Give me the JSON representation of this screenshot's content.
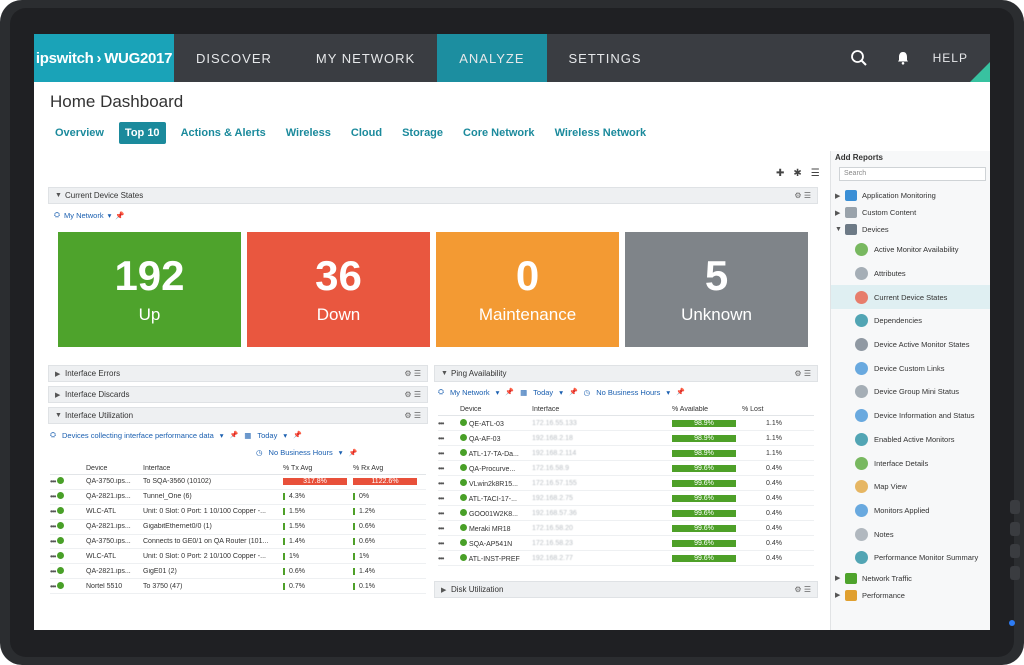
{
  "nav": {
    "brand": {
      "name": "ipswitch",
      "product": "WUG2017"
    },
    "items": [
      {
        "label": "DISCOVER"
      },
      {
        "label": "MY NETWORK"
      },
      {
        "label": "ANALYZE"
      },
      {
        "label": "SETTINGS"
      }
    ],
    "active": "ANALYZE",
    "help": "HELP"
  },
  "page": {
    "title": "Home Dashboard"
  },
  "tabs": [
    "Overview",
    "Top 10",
    "Actions & Alerts",
    "Wireless",
    "Cloud",
    "Storage",
    "Core Network",
    "Wireless Network"
  ],
  "active_tab": "Top 10",
  "current_device_states": {
    "title": "Current Device States",
    "scope": "My Network",
    "tiles": [
      {
        "count": "192",
        "label": "Up",
        "color": "#4ea32c"
      },
      {
        "count": "36",
        "label": "Down",
        "color": "#e9573f"
      },
      {
        "count": "0",
        "label": "Maintenance",
        "color": "#f39a33"
      },
      {
        "count": "5",
        "label": "Unknown",
        "color": "#7f8489"
      }
    ]
  },
  "panels": {
    "interface_errors": "Interface Errors",
    "interface_discards": "Interface Discards",
    "interface_utilization": "Interface Utilization",
    "ping_availability": "Ping Availability",
    "disk_utilization": "Disk Utilization"
  },
  "interface_utilization": {
    "scope": "Devices collecting interface performance data",
    "range": "Today",
    "hours": "No Business Hours",
    "columns": [
      "Device",
      "Interface",
      "% Tx Avg",
      "% Rx Avg"
    ],
    "rows": [
      {
        "device": "QA-3750.ips...",
        "iface": "To SQA-3560 (10102)",
        "tx": "317.8%",
        "rx": "1122.6%"
      },
      {
        "device": "QA-2821.ips...",
        "iface": "Tunnel_One (6)",
        "tx": "4.3%",
        "rx": "0%"
      },
      {
        "device": "WLC-ATL",
        "iface": "Unit: 0 Slot: 0 Port: 1 10/100 Copper -...",
        "tx": "1.5%",
        "rx": "1.2%"
      },
      {
        "device": "QA-2821.ips...",
        "iface": "GigabitEthernet0/0 (1)",
        "tx": "1.5%",
        "rx": "0.6%"
      },
      {
        "device": "QA-3750.ips...",
        "iface": "Connects to GE0/1 on QA Router (101...",
        "tx": "1.4%",
        "rx": "0.6%"
      },
      {
        "device": "WLC-ATL",
        "iface": "Unit: 0 Slot: 0 Port: 2 10/100 Copper -...",
        "tx": "1%",
        "rx": "1%"
      },
      {
        "device": "QA-2821.ips...",
        "iface": "GigE01 (2)",
        "tx": "0.6%",
        "rx": "1.4%"
      },
      {
        "device": "Nortel 5510",
        "iface": "To 3750 (47)",
        "tx": "0.7%",
        "rx": "0.1%"
      }
    ]
  },
  "ping_availability": {
    "scope": "My Network",
    "range": "Today",
    "hours": "No Business Hours",
    "columns": [
      "Device",
      "Interface",
      "% Available",
      "% Lost"
    ],
    "rows": [
      {
        "device": "QE-ATL-03",
        "iface": "172.16.55.133",
        "avail": "98.9%",
        "lost": "1.1%"
      },
      {
        "device": "QA-AF-03",
        "iface": "192.168.2.18",
        "avail": "98.9%",
        "lost": "1.1%"
      },
      {
        "device": "ATL-17-TA-Da...",
        "iface": "192.168.2.114",
        "avail": "98.9%",
        "lost": "1.1%"
      },
      {
        "device": "QA-Procurve...",
        "iface": "172.16.58.9",
        "avail": "99.6%",
        "lost": "0.4%"
      },
      {
        "device": "VLwin2k8R15...",
        "iface": "172.16.57.155",
        "avail": "99.6%",
        "lost": "0.4%"
      },
      {
        "device": "ATL-TACI-17-...",
        "iface": "192.168.2.75",
        "avail": "99.6%",
        "lost": "0.4%"
      },
      {
        "device": "GOO01W2K8...",
        "iface": "192.168.57.36",
        "avail": "99.6%",
        "lost": "0.4%"
      },
      {
        "device": "Meraki MR18",
        "iface": "172.16.58.20",
        "avail": "99.6%",
        "lost": "0.4%"
      },
      {
        "device": "SQA-AP541N",
        "iface": "172.16.58.23",
        "avail": "99.6%",
        "lost": "0.4%"
      },
      {
        "device": "ATL-INST-PREF",
        "iface": "192.168.2.77",
        "avail": "99.6%",
        "lost": "0.4%"
      }
    ]
  },
  "add_reports": {
    "title": "Add Reports",
    "search_placeholder": "Search",
    "groups": [
      {
        "label": "Application Monitoring"
      },
      {
        "label": "Custom Content"
      },
      {
        "label": "Devices"
      }
    ],
    "device_reports": [
      "Active Monitor Availability",
      "Attributes",
      "Current Device States",
      "Dependencies",
      "Device Active Monitor States",
      "Device Custom Links",
      "Device Group Mini Status",
      "Device Information and Status",
      "Enabled Active Monitors",
      "Interface Details",
      "Map View",
      "Monitors Applied",
      "Notes",
      "Performance Monitor Summary"
    ],
    "selected": "Current Device States",
    "more_groups": [
      {
        "label": "Network Traffic"
      },
      {
        "label": "Performance"
      }
    ]
  }
}
